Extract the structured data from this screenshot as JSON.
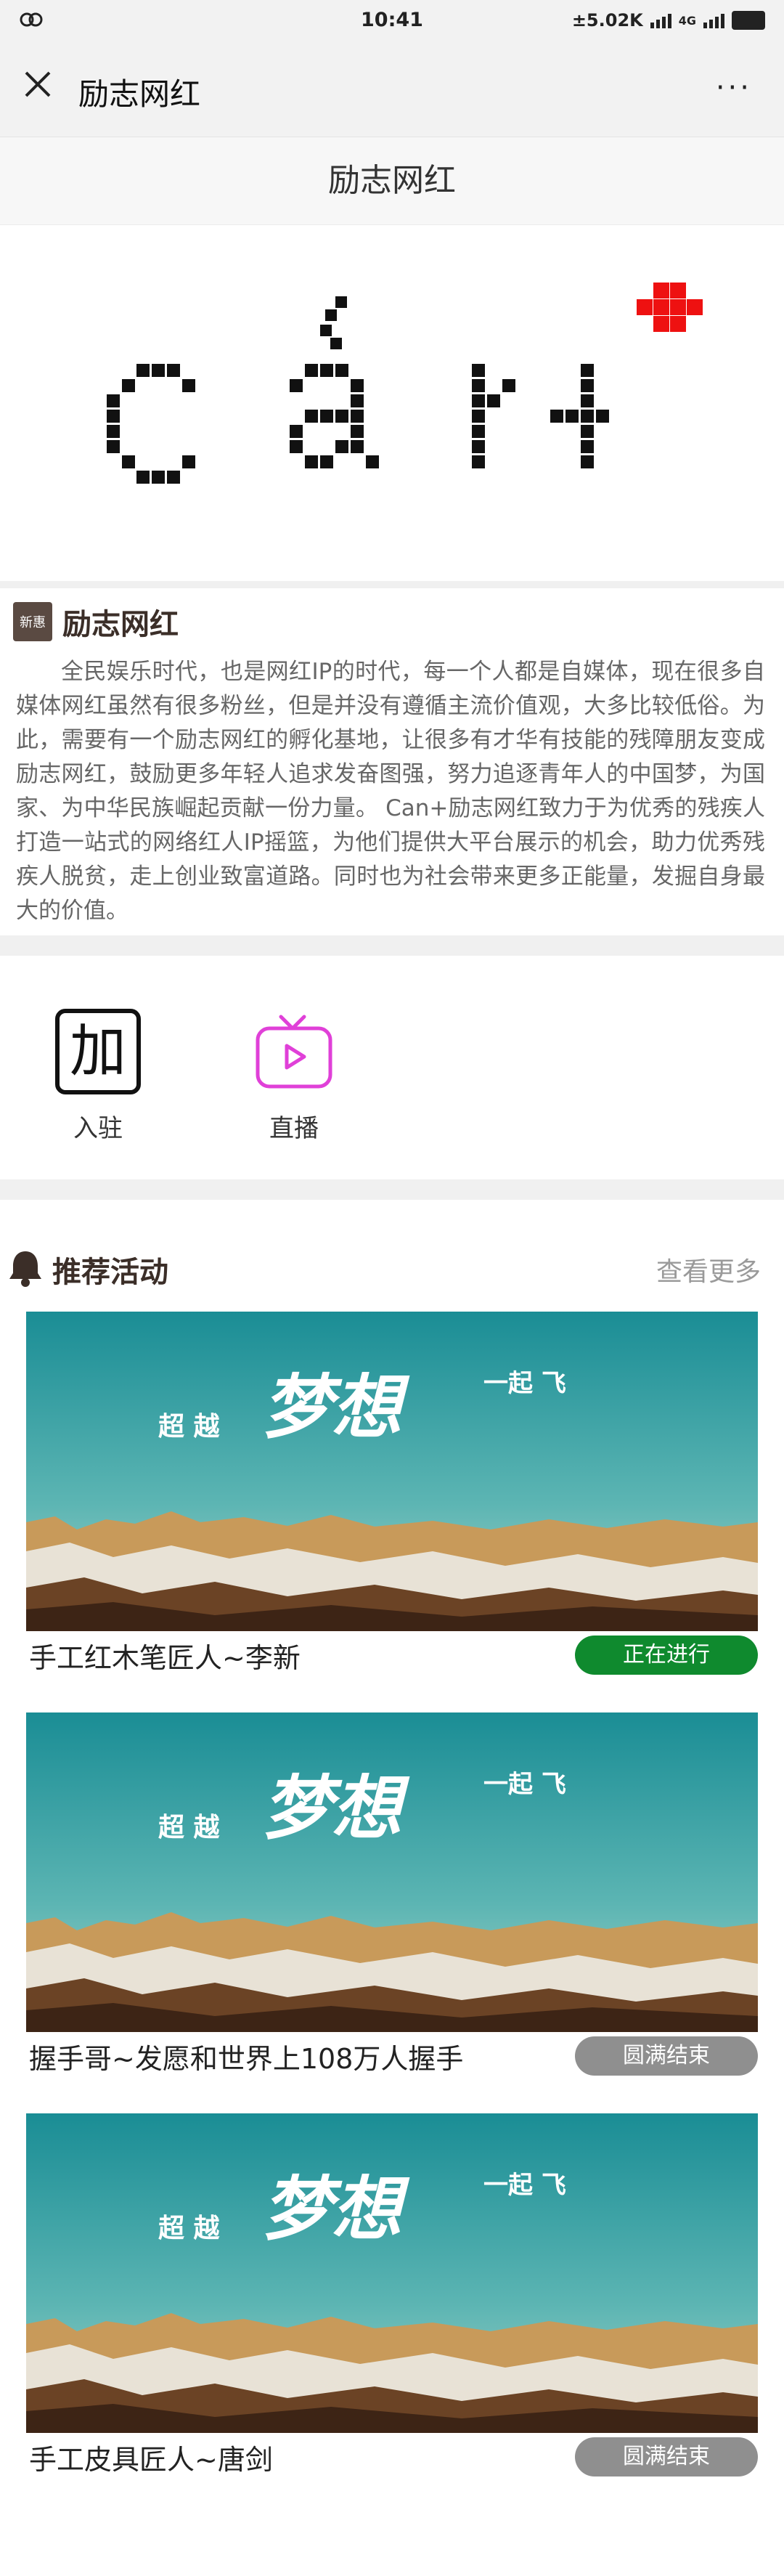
{
  "status": {
    "left_icon": "link-circles-icon",
    "time": "10:41",
    "speed": "±5.02K",
    "net": "4G"
  },
  "nav": {
    "title": "励志网红",
    "more": "···"
  },
  "page_title": "励志网红",
  "brand": {
    "wordmark": "Can+",
    "plus_color": "#ee1111"
  },
  "intro": {
    "logo_text": "新惠",
    "title": "励志网红",
    "text": "全民娱乐时代，也是网红IP的时代，每一个人都是自媒体，现在很多自媒体网红虽然有很多粉丝，但是并没有遵循主流价值观，大多比较低俗。为此，需要有一个励志网红的孵化基地，让很多有才华有技能的残障朋友变成励志网红，鼓励更多年轻人追求发奋图强，努力追逐青年人的中国梦，为国家、为中华民族崛起贡献一份力量。 Can+励志网红致力于为优秀的残疾人打造一站式的网络红人IP摇篮，为他们提供大平台展示的机会，助力优秀残疾人脱贫，走上创业致富道路。同时也为社会带来更多正能量，发掘自身最大的价值。"
  },
  "entries": [
    {
      "icon": "jia",
      "label": "入驻"
    },
    {
      "icon": "tv-play-icon",
      "label": "直播"
    }
  ],
  "section": {
    "title": "推荐活动",
    "more": "查看更多"
  },
  "banner_text": {
    "left": "超 越",
    "main": "梦想",
    "right": "一起 飞"
  },
  "activities": [
    {
      "name": "手工红木笔匠人~李新",
      "status": "正在进行",
      "status_color": "#0f8a2e"
    },
    {
      "name": "握手哥~发愿和世界上108万人握手",
      "status": "圆满结束",
      "status_color": "#8f8f8f"
    },
    {
      "name": "手工皮具匠人~唐剑",
      "status": "圆满结束",
      "status_color": "#8f8f8f"
    }
  ]
}
